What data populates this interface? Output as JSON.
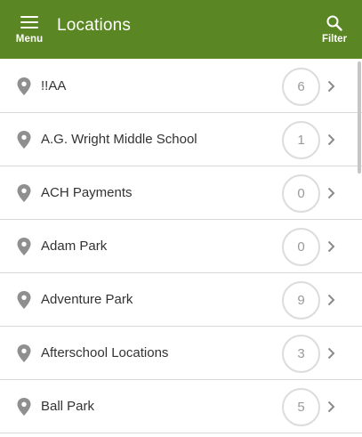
{
  "header": {
    "menu_label": "Menu",
    "title": "Locations",
    "filter_label": "Filter",
    "background_color": "#5a8623"
  },
  "locations": [
    {
      "name": "!!AA",
      "count": "6"
    },
    {
      "name": "A.G. Wright Middle School",
      "count": "1"
    },
    {
      "name": "ACH Payments",
      "count": "0"
    },
    {
      "name": "Adam Park",
      "count": "0"
    },
    {
      "name": "Adventure Park",
      "count": "9"
    },
    {
      "name": "Afterschool Locations",
      "count": "3"
    },
    {
      "name": "Ball Park",
      "count": "5"
    }
  ],
  "icons": {
    "menu": "hamburger-icon",
    "filter": "search-icon",
    "row_leading": "map-pin-icon",
    "row_trailing": "chevron-right-icon"
  }
}
